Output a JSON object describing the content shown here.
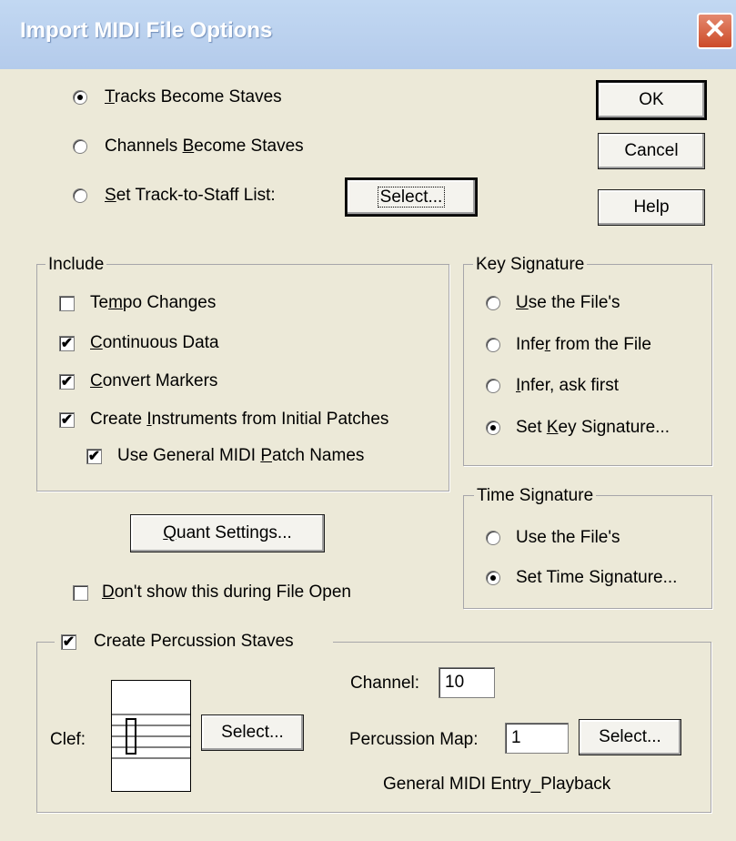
{
  "window": {
    "title": "Import MIDI File Options",
    "close_glyph": "✕"
  },
  "mode": {
    "tracks_label": "Tracks Become Staves",
    "channels_label": "Channels Become Staves",
    "list_label": "Set Track-to-Staff List:",
    "selected": "tracks",
    "select_button": "Select..."
  },
  "buttons": {
    "ok": "OK",
    "cancel": "Cancel",
    "help": "Help",
    "quant": "Quant Settings..."
  },
  "include": {
    "legend": "Include",
    "tempo": {
      "label": "Tempo Changes",
      "checked": false
    },
    "continuous": {
      "label": "Continuous Data",
      "checked": true
    },
    "markers": {
      "label": "Convert Markers",
      "checked": true
    },
    "instruments": {
      "label": "Create Instruments from Initial Patches",
      "checked": true
    },
    "patch_names": {
      "label": "Use General MIDI Patch Names",
      "checked": true
    }
  },
  "key_signature": {
    "legend": "Key Signature",
    "options": [
      "Use the File's",
      "Infer from the File",
      "Infer, ask first",
      "Set Key Signature..."
    ],
    "selected": "Set Key Signature..."
  },
  "time_signature": {
    "legend": "Time Signature",
    "options": [
      "Use the File's",
      "Set Time Signature..."
    ],
    "selected": "Set Time Signature..."
  },
  "dont_show": {
    "label": "Don't show this during File Open",
    "checked": false
  },
  "percussion": {
    "legend": "Create Percussion Staves",
    "checked": true,
    "clef_label": "Clef:",
    "clef_select": "Select...",
    "channel_label": "Channel:",
    "channel_value": "10",
    "map_label": "Percussion Map:",
    "map_value": "1",
    "map_select": "Select...",
    "map_name": "General MIDI Entry_Playback"
  }
}
